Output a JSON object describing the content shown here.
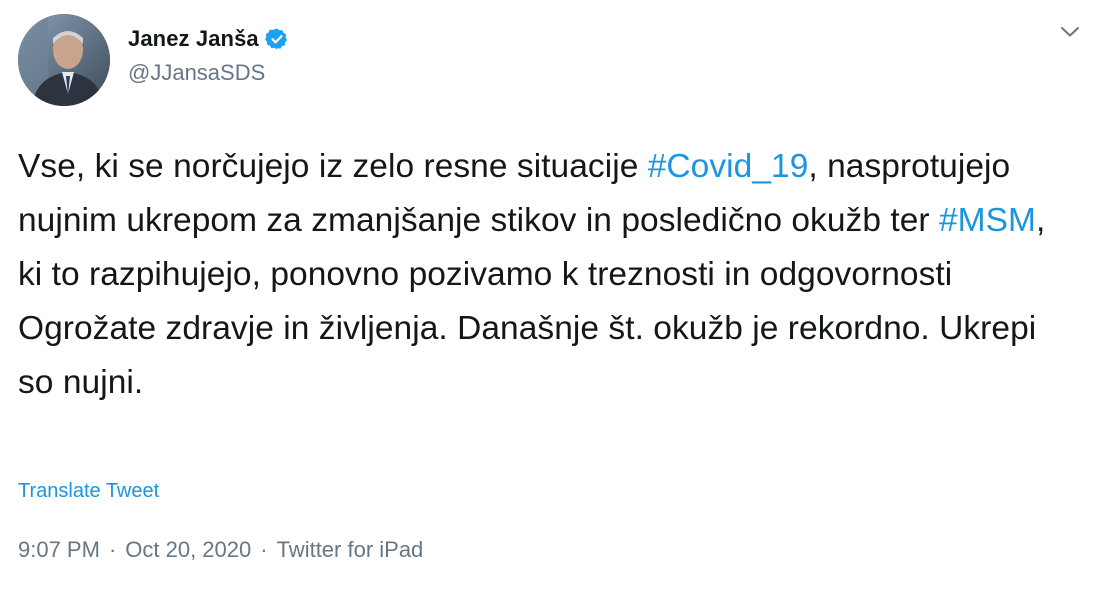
{
  "author": {
    "name": "Janez Janša",
    "handle": "@JJansaSDS",
    "avatar_icon": "user-avatar",
    "verified_icon": "verified-badge-icon",
    "verified_color": "#1da1f2"
  },
  "menu": {
    "icon": "chevron-down-icon"
  },
  "tweet": {
    "text_parts": [
      {
        "text": "Vse, ki se norčujejo iz zelo resne situacije "
      },
      {
        "text": "#Covid_19",
        "hashtag": true
      },
      {
        "text": ", "
      },
      {
        "text": "nasprotujejo nujnim ukrepom za zmanjšanje stikov in posledično okužb ter "
      },
      {
        "text": "#MSM",
        "hashtag": true
      },
      {
        "text": ", ki to razpihujejo, ponovno pozivamo k treznosti in odgovornosti Ogrožate zdravje in življenja. Današnje št. okužb je rekordno. Ukrepi so nujni."
      }
    ],
    "translate_label": "Translate Tweet",
    "link_color": "#1b95e0"
  },
  "meta": {
    "time": "9:07 PM",
    "separator": "·",
    "date": "Oct 20, 2020",
    "source": "Twitter for iPad"
  }
}
